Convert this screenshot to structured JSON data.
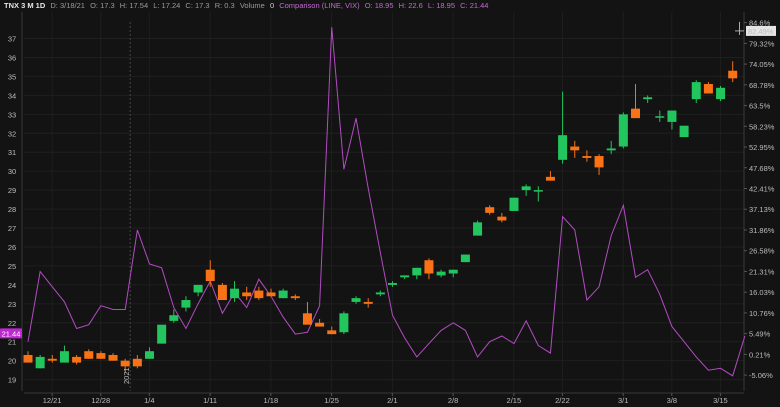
{
  "header": {
    "symbol": "TNX 3 M 1D",
    "date": "D: 3/18/21",
    "open": "O: 17.3",
    "high": "H: 17.54",
    "low": "L: 17.24",
    "close": "C: 17.3",
    "range": "R: 0.3",
    "volume": "Volume",
    "volume_value": "0",
    "comparison": "Comparison (LINE, VIX)",
    "cmp_open": "O: 18.95",
    "cmp_high": "H: 22.6",
    "cmp_low": "L: 18.95",
    "cmp_close": "C: 21.44"
  },
  "chart_data": {
    "type": "candlestick",
    "left_axis": {
      "range": [
        18.4,
        38.4
      ],
      "ticks": [
        "37",
        "36",
        "35",
        "34",
        "33",
        "32",
        "31",
        "30",
        "29",
        "28",
        "27",
        "26",
        "25",
        "24",
        "23",
        "22",
        "21",
        "20",
        "19"
      ]
    },
    "right_axis": {
      "range": [
        -9.1,
        87.3
      ],
      "ticks": [
        "84.6%",
        "79.32%",
        "74.05%",
        "68.78%",
        "63.5%",
        "58.23%",
        "52.95%",
        "47.68%",
        "42.41%",
        "37.13%",
        "31.86%",
        "26.58%",
        "21.31%",
        "16.03%",
        "10.76%",
        "5.49%",
        "0.21%",
        "-5.06%"
      ],
      "current_label": "82.49%"
    },
    "x_labels": [
      "12/21",
      "12/28",
      "1/4",
      "1/11",
      "1/18",
      "1/25",
      "2/1",
      "2/8",
      "2/15",
      "2/22",
      "3/1",
      "3/8",
      "3/15"
    ],
    "year_marker": "2021",
    "current_value_label": "21.44",
    "candles": [
      {
        "o": 20.3,
        "h": 20.5,
        "l": 19.9,
        "c": 19.9
      },
      {
        "o": 19.6,
        "h": 20.3,
        "l": 19.6,
        "c": 20.2
      },
      {
        "o": 20.1,
        "h": 20.3,
        "l": 19.9,
        "c": 20.0
      },
      {
        "o": 19.9,
        "h": 20.8,
        "l": 19.9,
        "c": 20.5
      },
      {
        "o": 20.2,
        "h": 20.3,
        "l": 19.8,
        "c": 19.9
      },
      {
        "o": 20.5,
        "h": 20.6,
        "l": 20.1,
        "c": 20.1
      },
      {
        "o": 20.4,
        "h": 20.5,
        "l": 20.1,
        "c": 20.1
      },
      {
        "o": 20.3,
        "h": 20.4,
        "l": 20.0,
        "c": 20.0
      },
      {
        "o": 20.0,
        "h": 20.1,
        "l": 19.4,
        "c": 19.7
      },
      {
        "o": 20.1,
        "h": 20.3,
        "l": 19.6,
        "c": 19.7
      },
      {
        "o": 20.1,
        "h": 20.7,
        "l": 20.1,
        "c": 20.5
      },
      {
        "o": 20.9,
        "h": 21.6,
        "l": 20.9,
        "c": 21.9
      },
      {
        "o": 22.1,
        "h": 22.7,
        "l": 22.0,
        "c": 22.4
      },
      {
        "o": 22.8,
        "h": 23.4,
        "l": 22.6,
        "c": 23.2
      },
      {
        "o": 23.6,
        "h": 23.9,
        "l": 23.4,
        "c": 24.0
      },
      {
        "o": 24.8,
        "h": 25.3,
        "l": 23.9,
        "c": 24.2
      },
      {
        "o": 24.0,
        "h": 24.1,
        "l": 23.2,
        "c": 23.2
      },
      {
        "o": 23.3,
        "h": 24.2,
        "l": 23.1,
        "c": 23.8
      },
      {
        "o": 23.6,
        "h": 23.9,
        "l": 23.2,
        "c": 23.4
      },
      {
        "o": 23.7,
        "h": 23.9,
        "l": 23.2,
        "c": 23.3
      },
      {
        "o": 23.6,
        "h": 23.8,
        "l": 23.4,
        "c": 23.4
      },
      {
        "o": 23.3,
        "h": 23.8,
        "l": 23.3,
        "c": 23.7
      },
      {
        "o": 23.4,
        "h": 23.5,
        "l": 23.2,
        "c": 23.3
      },
      {
        "o": 22.5,
        "h": 23.1,
        "l": 22.2,
        "c": 21.9
      },
      {
        "o": 22.0,
        "h": 22.2,
        "l": 21.8,
        "c": 21.8
      },
      {
        "o": 21.6,
        "h": 21.8,
        "l": 21.4,
        "c": 21.4
      },
      {
        "o": 21.5,
        "h": 22.6,
        "l": 21.4,
        "c": 22.5
      },
      {
        "o": 23.1,
        "h": 23.4,
        "l": 23.0,
        "c": 23.3
      },
      {
        "o": 23.1,
        "h": 23.3,
        "l": 22.8,
        "c": 23.0
      },
      {
        "o": 23.5,
        "h": 23.7,
        "l": 23.4,
        "c": 23.6
      },
      {
        "o": 24.0,
        "h": 24.2,
        "l": 23.9,
        "c": 24.1
      },
      {
        "o": 24.4,
        "h": 24.5,
        "l": 24.3,
        "c": 24.5
      },
      {
        "o": 24.5,
        "h": 24.9,
        "l": 24.3,
        "c": 24.9
      },
      {
        "o": 25.3,
        "h": 25.4,
        "l": 24.3,
        "c": 24.6
      },
      {
        "o": 24.5,
        "h": 24.8,
        "l": 24.4,
        "c": 24.7
      },
      {
        "o": 24.6,
        "h": 24.8,
        "l": 24.4,
        "c": 24.8
      },
      {
        "o": 25.2,
        "h": 25.6,
        "l": 25.2,
        "c": 25.6
      },
      {
        "o": 26.6,
        "h": 27.4,
        "l": 26.6,
        "c": 27.3
      },
      {
        "o": 28.1,
        "h": 28.2,
        "l": 27.7,
        "c": 27.8
      },
      {
        "o": 27.6,
        "h": 27.8,
        "l": 27.3,
        "c": 27.4
      },
      {
        "o": 27.9,
        "h": 28.6,
        "l": 27.9,
        "c": 28.6
      },
      {
        "o": 29.0,
        "h": 29.3,
        "l": 28.7,
        "c": 29.2
      },
      {
        "o": 29.0,
        "h": 29.2,
        "l": 28.4,
        "c": 29.0
      },
      {
        "o": 29.7,
        "h": 30.0,
        "l": 29.5,
        "c": 29.5
      },
      {
        "o": 30.6,
        "h": 34.2,
        "l": 30.4,
        "c": 31.9
      },
      {
        "o": 31.3,
        "h": 31.6,
        "l": 30.7,
        "c": 31.1
      },
      {
        "o": 30.8,
        "h": 31.1,
        "l": 30.5,
        "c": 30.7
      },
      {
        "o": 30.8,
        "h": 30.9,
        "l": 29.8,
        "c": 30.2
      },
      {
        "o": 31.1,
        "h": 31.6,
        "l": 30.9,
        "c": 31.2
      },
      {
        "o": 31.3,
        "h": 33.1,
        "l": 31.2,
        "c": 33.0
      },
      {
        "o": 33.3,
        "h": 34.6,
        "l": 32.8,
        "c": 32.8
      },
      {
        "o": 33.8,
        "h": 34.0,
        "l": 33.6,
        "c": 33.9
      },
      {
        "o": 32.9,
        "h": 33.2,
        "l": 32.6,
        "c": 32.9
      },
      {
        "o": 32.6,
        "h": 33.2,
        "l": 32.2,
        "c": 33.2
      },
      {
        "o": 31.8,
        "h": 32.1,
        "l": 31.8,
        "c": 32.4
      },
      {
        "o": 33.8,
        "h": 34.8,
        "l": 33.6,
        "c": 34.7
      },
      {
        "o": 34.6,
        "h": 34.7,
        "l": 34.1,
        "c": 34.1
      },
      {
        "o": 33.8,
        "h": 34.5,
        "l": 33.7,
        "c": 34.4
      },
      {
        "o": 35.3,
        "h": 35.8,
        "l": 34.7,
        "c": 34.9
      }
    ],
    "comparison_series": {
      "name": "VIX",
      "values": [
        21.0,
        24.7,
        23.9,
        23.1,
        21.7,
        21.9,
        22.9,
        22.7,
        22.7,
        26.9,
        25.1,
        24.9,
        22.8,
        21.7,
        23.0,
        24.2,
        22.5,
        23.6,
        22.8,
        24.3,
        23.4,
        22.3,
        21.4,
        21.5,
        22.9,
        37.6,
        30.1,
        32.8,
        29.1,
        25.7,
        22.4,
        21.2,
        20.2,
        20.9,
        21.6,
        22.0,
        21.6,
        20.2,
        21.0,
        21.3,
        20.9,
        22.1,
        20.8,
        20.4,
        27.6,
        26.9,
        23.2,
        23.9,
        26.6,
        28.2,
        24.4,
        24.8,
        23.5,
        21.8,
        21.0,
        20.2,
        19.5,
        19.6,
        19.2,
        21.3
      ],
      "color": "#b24cc2"
    },
    "up_color": "#22c55e",
    "down_color": "#f97316",
    "grid": true
  }
}
